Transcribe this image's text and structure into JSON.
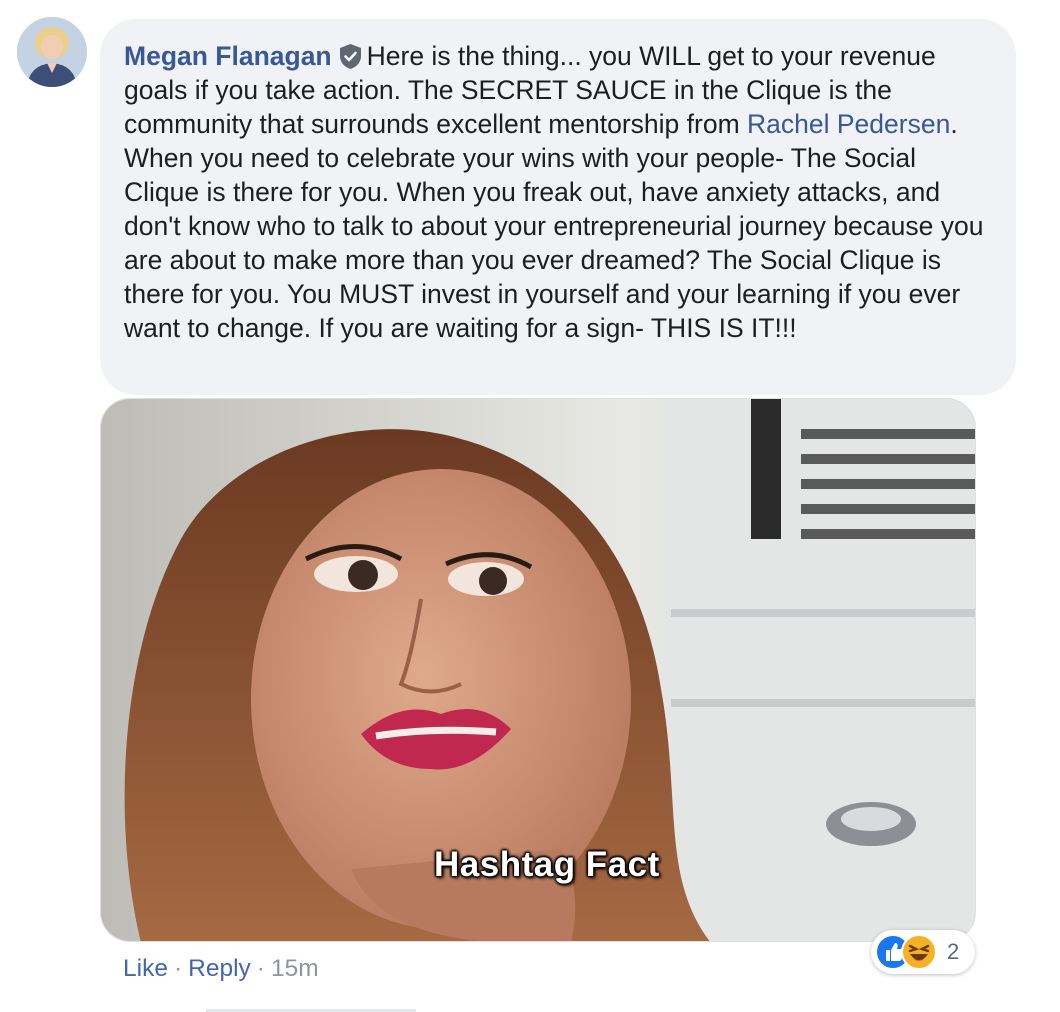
{
  "comment": {
    "author": "Megan Flanagan",
    "verified_icon": "verified-badge-icon",
    "text_before_mention": "Here is the thing... you WILL get to your revenue goals if you take action. The SECRET SAUCE in the Clique is the community that surrounds excellent mentorship from ",
    "mention": "Rachel Pedersen",
    "text_after_mention": ". When you need to celebrate your wins with your people- The Social Clique is there for you. When you freak out, have anxiety attacks, and don't know who to talk to about your entrepreneurial journey because you are about to make more than you ever dreamed? The Social Clique is there for you. You MUST invest in yourself and your learning if you ever want to change. If you are waiting for a sign- THIS IS IT!!!"
  },
  "gif": {
    "caption": "Hashtag Fact"
  },
  "actions": {
    "like": "Like",
    "separator": "·",
    "reply": "Reply",
    "time": "15m"
  },
  "reactions": {
    "icons": [
      "like-icon",
      "haha-icon"
    ],
    "count": "2"
  },
  "colors": {
    "link": "#385898",
    "action_link": "#4267b2",
    "bubble_bg": "#f0f2f5",
    "like_blue": "#1877f2",
    "haha_yellow": "#f7b125"
  }
}
